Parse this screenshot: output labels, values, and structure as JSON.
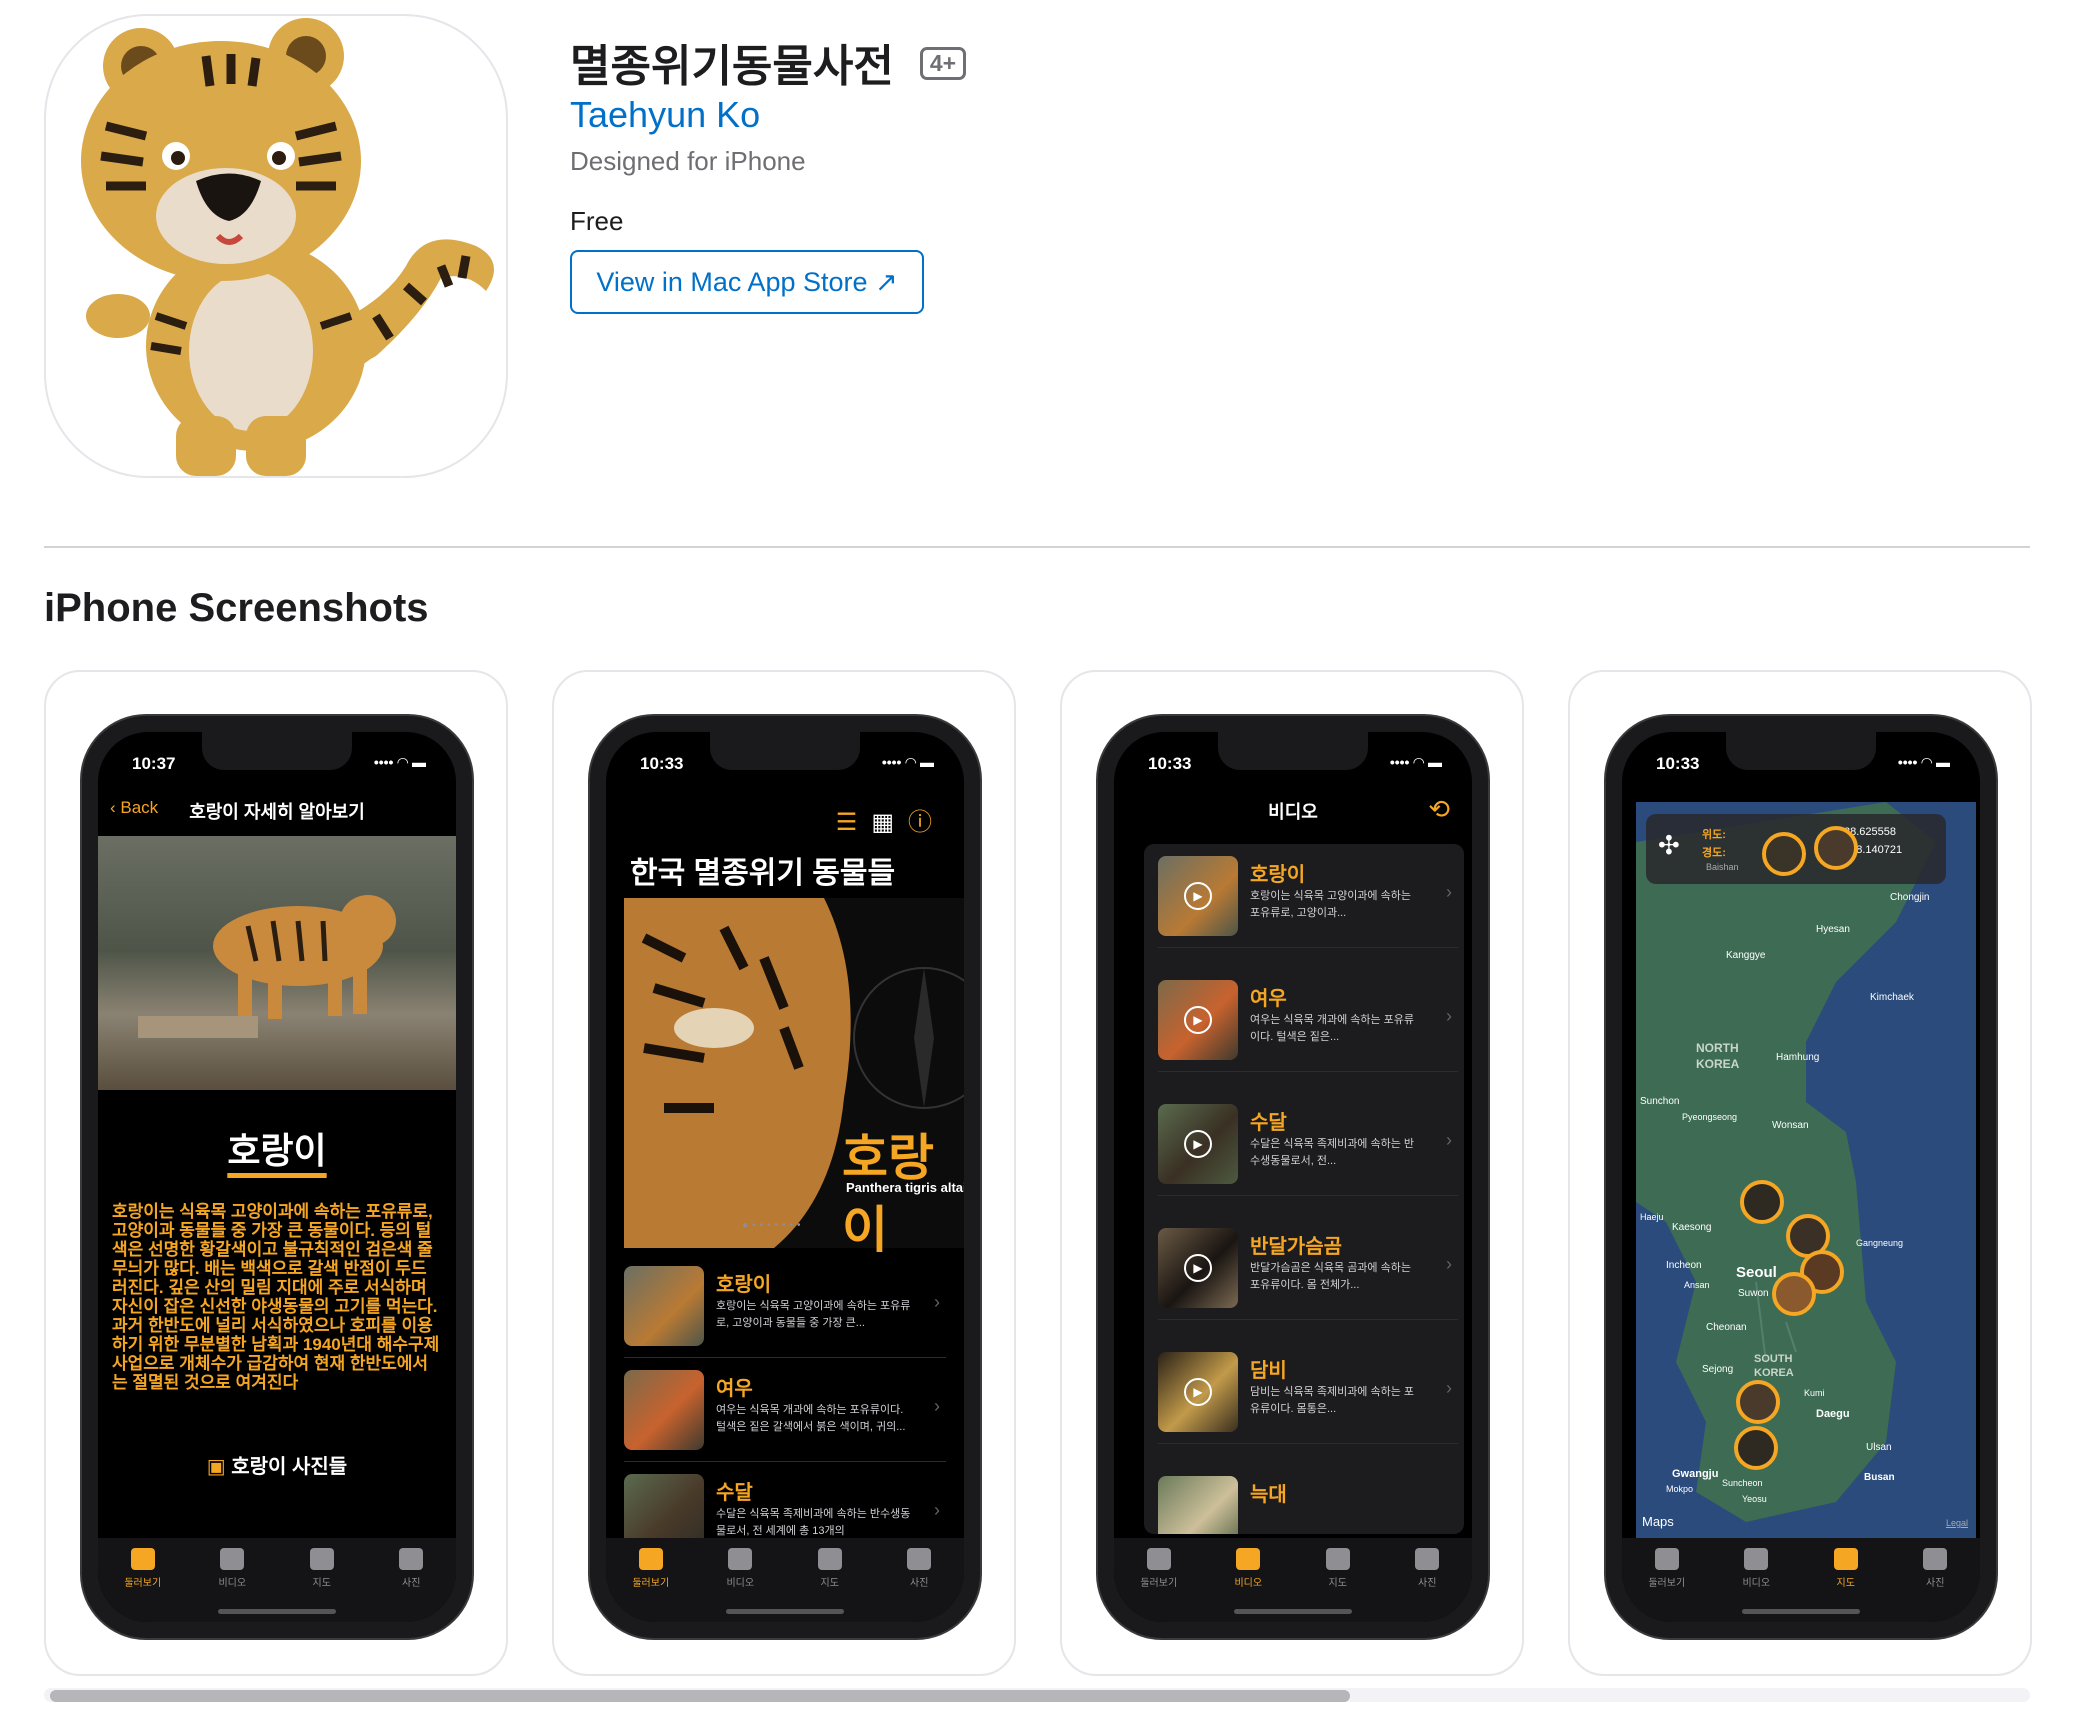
{
  "app": {
    "title": "멸종위기동물사전",
    "age_rating": "4+",
    "developer": "Taehyun Ko",
    "designed_for": "Designed for iPhone",
    "price": "Free",
    "store_button": "View in Mac App Store ↗"
  },
  "section_title": "iPhone Screenshots",
  "screens": [
    {
      "time": "10:37",
      "back_label": "Back",
      "nav_title": "호랑이 자세히 알아보기",
      "animal_name": "호랑이",
      "description": "호랑이는 식육목 고양이과에 속하는 포유류로, 고양이과 동물들 중 가장 큰 동물이다. 등의 털색은 선명한 황갈색이고 불규칙적인 검은색 줄무늬가 많다. 배는 백색으로 갈색 반점이 두드러진다. 깊은 산의 밀림 지대에 주로 서식하며 자신이 잡은 신선한 야생동물의 고기를 먹는다. 과거 한반도에 널리 서식하였으나 호피를 이용하기 위한 무분별한 남획과 1940년대 해수구제사업으로 개체수가 급감하여 현재 한반도에서는 절멸된 것으로 여겨진다",
      "photos_label": "호랑이 사진들",
      "tabs": [
        "둘러보기",
        "비디오",
        "지도",
        "사진"
      ],
      "active_tab": 0
    },
    {
      "time": "10:33",
      "heading": "한국 멸종위기 동물들",
      "hero_name": "호랑이",
      "hero_sci": "Panthera tigris altaica",
      "rows": [
        {
          "title": "호랑이",
          "desc": "호랑이는 식육목 고양이과에 속하는 포유류로, 고양이과 동물들 중 가장 큰..."
        },
        {
          "title": "여우",
          "desc": "여우는 식육목 개과에 속하는 포유류이다. 털색은 짙은 갈색에서 붉은 색이며, 귀의..."
        },
        {
          "title": "수달",
          "desc": "수달은 식육목 족제비과에 속하는 반수생동물로서, 전 세계에 총 13개의"
        }
      ],
      "tabs": [
        "둘러보기",
        "비디오",
        "지도",
        "사진"
      ],
      "active_tab": 0
    },
    {
      "time": "10:33",
      "nav_title": "비디오",
      "rows": [
        {
          "title": "호랑이",
          "desc": "호랑이는 식육목 고양이과에 속하는 포유류로, 고양이과..."
        },
        {
          "title": "여우",
          "desc": "여우는 식육목 개과에 속하는 포유류이다. 털색은 짙은..."
        },
        {
          "title": "수달",
          "desc": "수달은 식육목 족제비과에 속하는 반수생동물로서, 전..."
        },
        {
          "title": "반달가슴곰",
          "desc": "반달가슴곰은 식육목 곰과에 속하는 포유류이다. 몸 전체가..."
        },
        {
          "title": "담비",
          "desc": "담비는 식육목 족제비과에 속하는 포유류이다. 몸통은..."
        },
        {
          "title": "늑대",
          "desc": ""
        }
      ],
      "tabs": [
        "둘러보기",
        "비디오",
        "지도",
        "사진"
      ],
      "active_tab": 1
    },
    {
      "time": "10:33",
      "lat_label": "위도:",
      "lon_label": "경도:",
      "lat_value": "38.625558",
      "lon_value": "128.140721",
      "map_labels": [
        "Baishan",
        "Chongjin",
        "Hyesan",
        "Kanggye",
        "Kimchaek",
        "NORTH KOREA",
        "Hamhung",
        "Sunchon",
        "Pyeongseong",
        "Wonsan",
        "Haeju",
        "Kaesong",
        "Incheon",
        "Seoul",
        "Ansan",
        "Suwon",
        "Gangneung",
        "Cheonan",
        "Sejong",
        "SOUTH KOREA",
        "Kumi",
        "Daegu",
        "Ulsan",
        "Gwangju",
        "Mokpo",
        "Suncheon",
        "Yeosu",
        "Busan"
      ],
      "maps_credit": "Maps",
      "legal": "Legal",
      "tabs": [
        "둘러보기",
        "비디오",
        "지도",
        "사진"
      ],
      "active_tab": 2
    }
  ],
  "colors": {
    "accent": "#f5a623",
    "link": "#0070c9",
    "map_sea": "#2a4b7c",
    "map_land": "#3e6b54"
  }
}
